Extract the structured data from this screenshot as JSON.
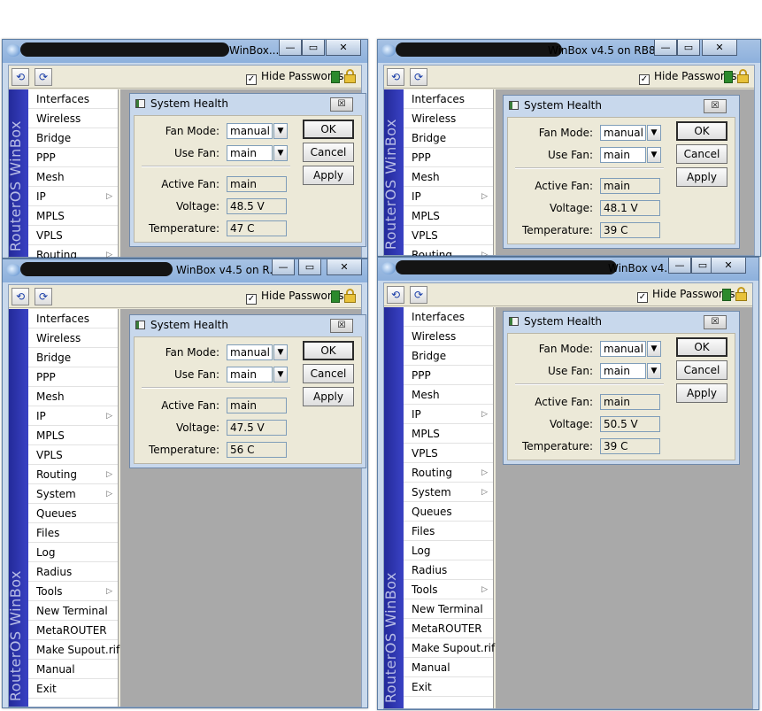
{
  "common": {
    "hide_passwords_label": "Hide Passwords",
    "check_mark": "✓",
    "brand": "RouterOS WinBox",
    "menu_items": [
      {
        "label": "Interfaces",
        "submenu": false
      },
      {
        "label": "Wireless",
        "submenu": false
      },
      {
        "label": "Bridge",
        "submenu": false
      },
      {
        "label": "PPP",
        "submenu": false
      },
      {
        "label": "Mesh",
        "submenu": false
      },
      {
        "label": "IP",
        "submenu": true
      },
      {
        "label": "MPLS",
        "submenu": false
      },
      {
        "label": "VPLS",
        "submenu": false
      },
      {
        "label": "Routing",
        "submenu": true
      },
      {
        "label": "System",
        "submenu": true
      },
      {
        "label": "Queues",
        "submenu": false
      },
      {
        "label": "Files",
        "submenu": false
      },
      {
        "label": "Log",
        "submenu": false
      },
      {
        "label": "Radius",
        "submenu": false
      },
      {
        "label": "Tools",
        "submenu": true
      },
      {
        "label": "New Terminal",
        "submenu": false
      },
      {
        "label": "MetaROUTER",
        "submenu": false
      },
      {
        "label": "Make Supout.rif",
        "submenu": false
      },
      {
        "label": "Manual",
        "submenu": false
      },
      {
        "label": "Exit",
        "submenu": false
      }
    ],
    "dialog": {
      "title": "System Health",
      "fan_mode_label": "Fan Mode:",
      "use_fan_label": "Use Fan:",
      "active_fan_label": "Active Fan:",
      "voltage_label": "Voltage:",
      "temperature_label": "Temperature:",
      "ok_label": "OK",
      "cancel_label": "Cancel",
      "apply_label": "Apply"
    },
    "icons": {
      "undo": "⟲",
      "redo": "⟳",
      "dropdown": "▼",
      "submenu_arrow": "▷",
      "close_small": "☒"
    }
  },
  "windows": [
    {
      "title": "WinBox...",
      "fan_mode": "manual",
      "use_fan": "main",
      "active_fan": "main",
      "voltage": "48.5 V",
      "temperature": "47 C"
    },
    {
      "title": "WinBox v4.5 on RB8...",
      "fan_mode": "manual",
      "use_fan": "main",
      "active_fan": "main",
      "voltage": "48.1 V",
      "temperature": "39 C"
    },
    {
      "title": "WinBox v4.5 on R...",
      "fan_mode": "manual",
      "use_fan": "main",
      "active_fan": "main",
      "voltage": "47.5 V",
      "temperature": "56 C"
    },
    {
      "title": "WinBox v4...",
      "fan_mode": "manual",
      "use_fan": "main",
      "active_fan": "main",
      "voltage": "50.5 V",
      "temperature": "39 C"
    }
  ]
}
